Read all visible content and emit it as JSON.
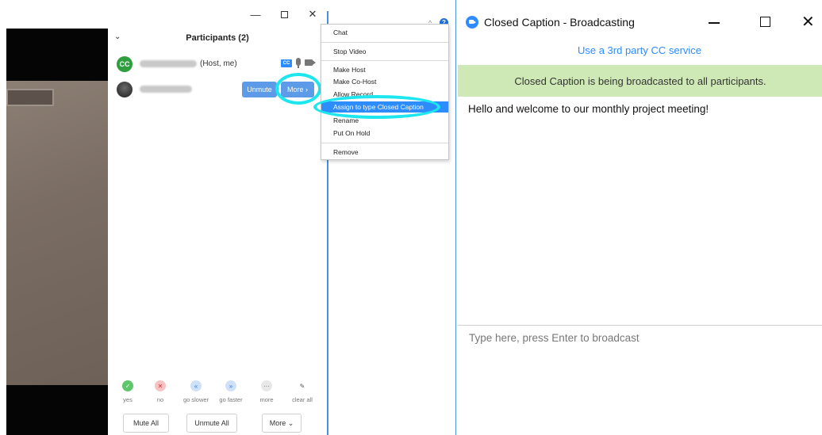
{
  "participants_panel": {
    "title": "Participants (2)",
    "collapse_icon": "chevron-down-icon",
    "participants": [
      {
        "avatar_text": "CC",
        "role_label": "(Host, me)",
        "cc_badge": "CC"
      },
      {
        "unmute_label": "Unmute",
        "more_label": "More ›"
      }
    ],
    "reactions": [
      {
        "label": "yes",
        "glyph": "✓"
      },
      {
        "label": "no",
        "glyph": "✕"
      },
      {
        "label": "go slower",
        "glyph": "«"
      },
      {
        "label": "go faster",
        "glyph": "»"
      },
      {
        "label": "more",
        "glyph": "···"
      },
      {
        "label": "clear all",
        "glyph": "✎"
      }
    ],
    "buttons": {
      "mute_all": "Mute All",
      "unmute_all": "Unmute All",
      "more": "More ⌄"
    }
  },
  "window_controls": {
    "minimize": "—",
    "maximize": "",
    "close": "✕"
  },
  "context_menu": {
    "items": [
      "Chat",
      "Stop Video",
      "Make Host",
      "Make Co-Host",
      "Allow Record",
      "Assign to type Closed Caption",
      "Rename",
      "Put On Hold",
      "Remove"
    ],
    "highlighted_item": "Assign to type Closed Caption"
  },
  "middle_column": {
    "help_glyph": "?",
    "caret_glyph": "^"
  },
  "cc_window": {
    "title": "Closed Caption - Broadcasting",
    "third_party_link": "Use a 3rd party CC service",
    "banner": "Closed Caption is being broadcasted to all participants.",
    "caption_text": "Hello and welcome to our monthly project meeting!",
    "input_placeholder": "Type here, press Enter to broadcast",
    "colors": {
      "accent": "#2d8cff",
      "banner_bg": "#cfe9b6"
    }
  }
}
